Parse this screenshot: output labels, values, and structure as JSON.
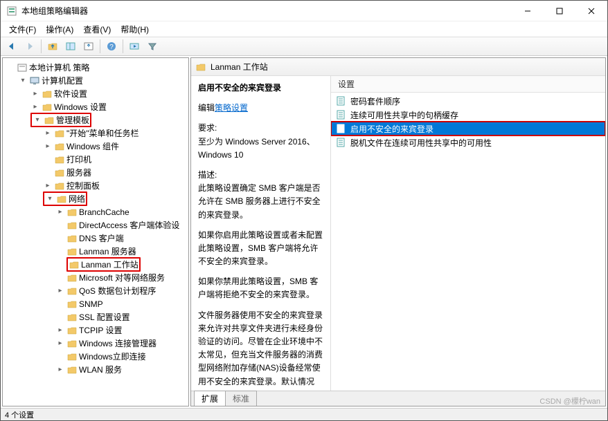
{
  "window": {
    "title": "本地组策略编辑器"
  },
  "menu": {
    "file": "文件(F)",
    "action": "操作(A)",
    "view": "查看(V)",
    "help": "帮助(H)"
  },
  "tree": {
    "root": "本地计算机 策略",
    "computer_config": "计算机配置",
    "software_settings": "软件设置",
    "windows_settings": "Windows 设置",
    "admin_templates": "管理模板",
    "start_taskbar": "\"开始\"菜单和任务栏",
    "windows_components": "Windows 组件",
    "printers": "打印机",
    "servers": "服务器",
    "control_panel": "控制面板",
    "network": "网络",
    "net": {
      "branchcache": "BranchCache",
      "directaccess": "DirectAccess 客户端体验设",
      "dns_client": "DNS 客户端",
      "lanman_server": "Lanman 服务器",
      "lanman_workstation": "Lanman 工作站",
      "ms_peer": "Microsoft 对等网络服务",
      "qos": "QoS 数据包计划程序",
      "snmp": "SNMP",
      "ssl": "SSL 配置设置",
      "tcpip": "TCPIP 设置",
      "wcm": "Windows 连接管理器",
      "winconnectnow": "Windows立即连接",
      "wlan": "WLAN 服务"
    }
  },
  "breadcrumb": {
    "title": "Lanman 工作站"
  },
  "detail": {
    "title": "启用不安全的来宾登录",
    "edit_prefix": "编辑",
    "edit_link": "策略设置",
    "req_label": "要求:",
    "req_body": "至少为 Windows Server 2016、Windows 10",
    "desc_label": "描述:",
    "desc1": "此策略设置确定 SMB 客户端是否允许在 SMB 服务器上进行不安全的来宾登录。",
    "desc2": "如果你启用此策略设置或者未配置此策略设置，SMB 客户端将允许不安全的来宾登录。",
    "desc3": "如果你禁用此策略设置，SMB 客户端将拒绝不安全的来宾登录。",
    "desc4": "文件服务器使用不安全的来宾登录来允许对共享文件夹进行未经身份验证的访问。尽管在企业环境中不太常见，但充当文件服务器的消费型网络附加存储(NAS)设备经常使用不安全的来宾登录。默认情况"
  },
  "settings": {
    "header": "设置",
    "items": [
      "密码套件顺序",
      "连续可用性共享中的句柄缓存",
      "启用不安全的来宾登录",
      "脱机文件在连续可用性共享中的可用性"
    ],
    "selected_index": 2
  },
  "tabs": {
    "extended": "扩展",
    "standard": "标准"
  },
  "status": "4 个设置",
  "watermark": "CSDN @檬柠wan"
}
